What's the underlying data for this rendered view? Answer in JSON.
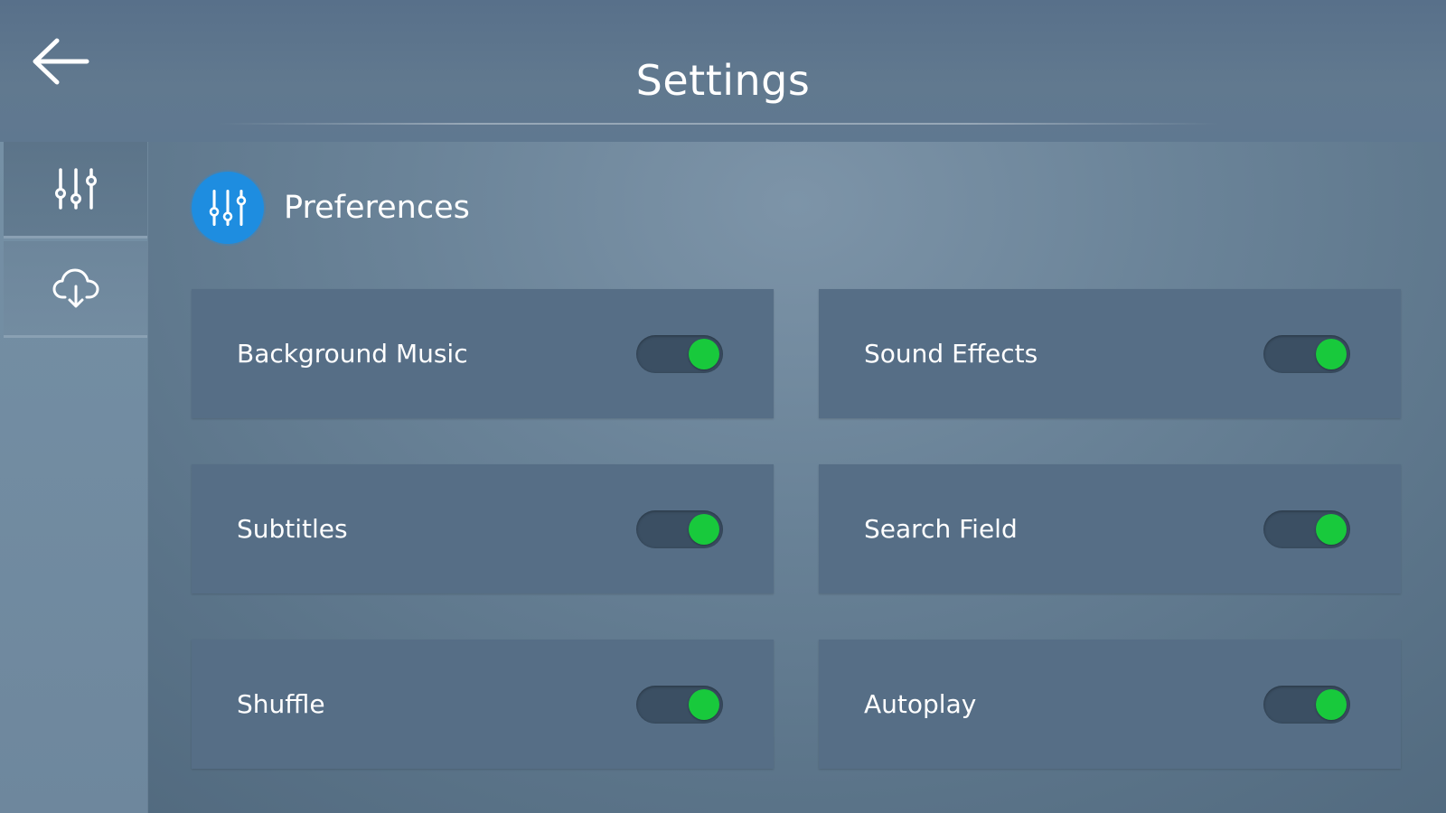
{
  "header": {
    "title": "Settings",
    "back_icon": "arrow-left-icon"
  },
  "sidebar": {
    "items": [
      {
        "icon": "sliders-icon",
        "active": true
      },
      {
        "icon": "cloud-download-icon",
        "active": false
      }
    ]
  },
  "section": {
    "icon": "sliders-icon",
    "title": "Preferences",
    "badge_color": "#1e8de0"
  },
  "settings": [
    {
      "label": "Background Music",
      "on": true
    },
    {
      "label": "Sound Effects",
      "on": true
    },
    {
      "label": "Subtitles",
      "on": true
    },
    {
      "label": "Search Field",
      "on": true
    },
    {
      "label": "Shuffle",
      "on": true
    },
    {
      "label": "Autoplay",
      "on": true
    }
  ],
  "colors": {
    "toggle_on": "#18c93c",
    "toggle_track": "#3b4f63",
    "card_bg": "#566e86"
  }
}
